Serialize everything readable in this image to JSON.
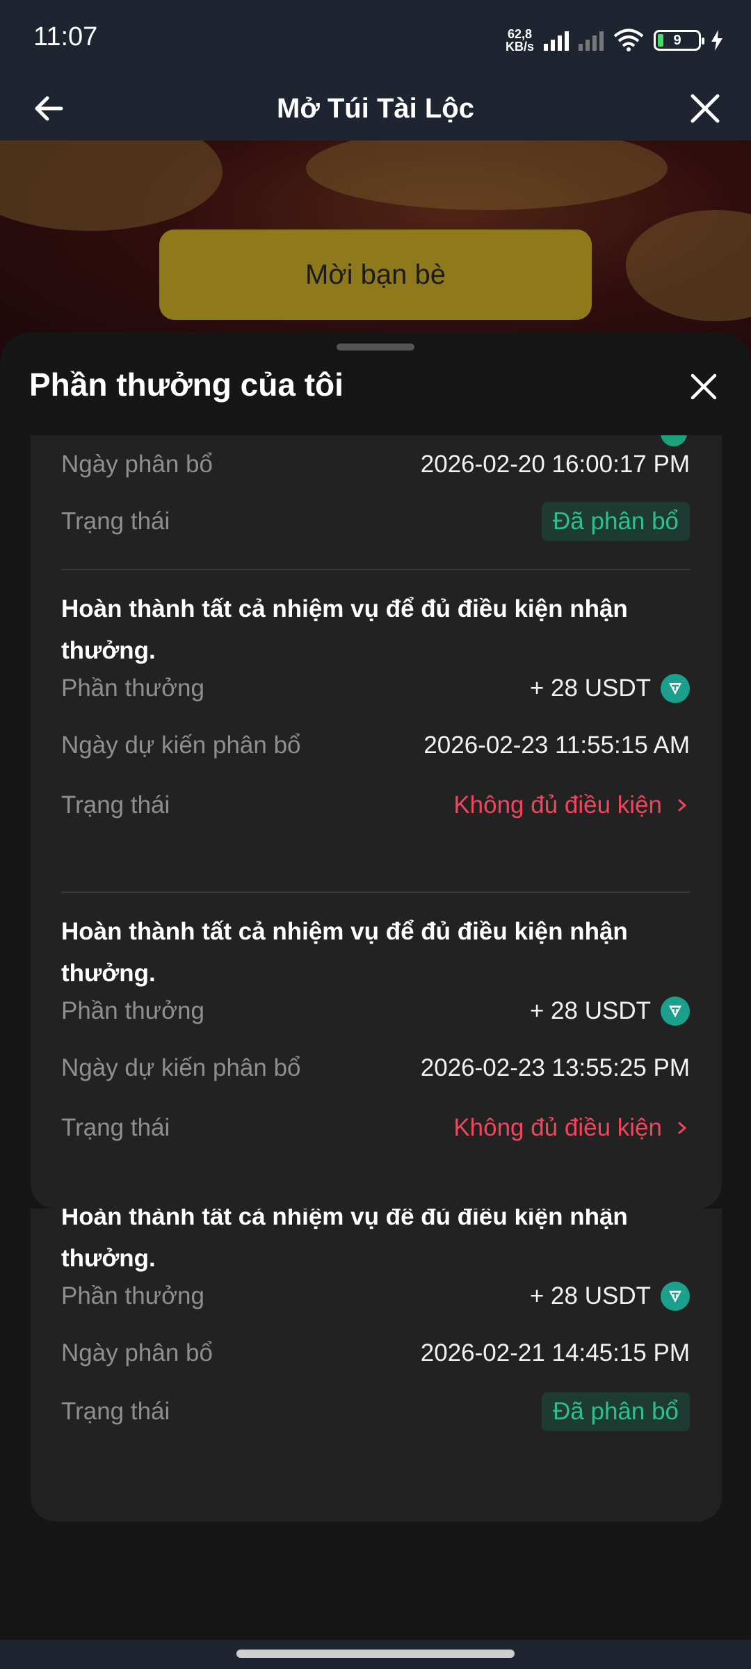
{
  "status_bar": {
    "time": "11:07",
    "net_speed_value": "62,8",
    "net_speed_unit": "KB/s",
    "battery": "9"
  },
  "header": {
    "title": "Mở Túi Tài Lộc",
    "back_icon": "arrow-left-icon",
    "close_icon": "close-icon"
  },
  "banner": {
    "invite_label": "Mời bạn bè"
  },
  "sheet": {
    "title": "Phần thưởng của tôi",
    "labels": {
      "reward": "Phần thưởng",
      "alloc_date": "Ngày phân bổ",
      "expected_date": "Ngày dự kiến phân bổ",
      "status": "Trạng thái"
    },
    "first": {
      "date": "2026-02-20 16:00:17 PM",
      "status": "Đã phân bổ"
    },
    "items": [
      {
        "task": "Hoàn thành tất cả nhiệm vụ để đủ điều kiện nhận thưởng.",
        "reward": "+ 28 USDT",
        "date": "2026-02-23 11:55:15 AM",
        "status": "Không đủ điều kiện"
      },
      {
        "task": "Hoàn thành tất cả nhiệm vụ để đủ điều kiện nhận thưởng.",
        "reward": "+ 28 USDT",
        "date": "2026-02-23 13:55:25 PM",
        "status": "Không đủ điều kiện"
      },
      {
        "task": "Hoàn thành tất cả nhiệm vụ để đủ điều kiện nhận thưởng.",
        "reward": "+ 28 USDT",
        "date": "2026-02-21 14:45:15 PM",
        "status": "Đã phân bổ"
      }
    ]
  },
  "colors": {
    "success": "#2fbf8f",
    "error": "#f0455b",
    "accent_gold": "#8e7a1d",
    "usdt": "#1aa08d"
  }
}
